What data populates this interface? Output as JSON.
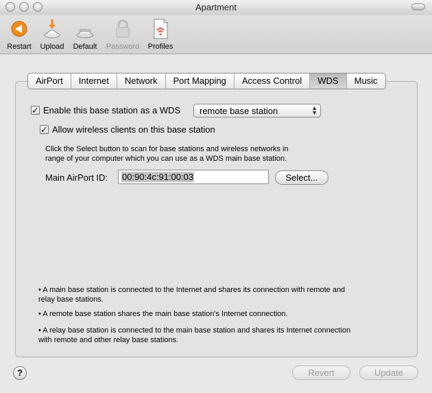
{
  "window": {
    "title": "Apartment"
  },
  "toolbar": {
    "items": [
      {
        "label": "Restart",
        "icon": "restart-icon",
        "enabled": true
      },
      {
        "label": "Upload",
        "icon": "upload-icon",
        "enabled": true
      },
      {
        "label": "Default",
        "icon": "default-icon",
        "enabled": true
      },
      {
        "label": "Password",
        "icon": "lock-icon",
        "enabled": false
      },
      {
        "label": "Profiles",
        "icon": "profiles-icon",
        "enabled": true
      }
    ]
  },
  "tabs": [
    {
      "label": "AirPort"
    },
    {
      "label": "Internet"
    },
    {
      "label": "Network"
    },
    {
      "label": "Port Mapping"
    },
    {
      "label": "Access Control"
    },
    {
      "label": "WDS",
      "active": true
    },
    {
      "label": "Music"
    }
  ],
  "wds": {
    "enable_label": "Enable this base station as a WDS",
    "enable_checked": true,
    "mode_value": "remote base station",
    "allow_label": "Allow wireless clients on this base station",
    "allow_checked": true,
    "instructions_line1": "Click the Select button to scan for base stations and wireless networks in",
    "instructions_line2": "range of your computer which you can use as a WDS main base station.",
    "main_id_label": "Main AirPort ID:",
    "main_id_value": "00:90:4c:91:00:03",
    "select_button": "Select..."
  },
  "notes": {
    "main_line1": "• A main base station is connected to the Internet and shares its connection with remote and",
    "main_line2": "relay base stations.",
    "remote": "• A remote base station shares the main base station's Internet connection.",
    "relay_line1": "• A relay base station is connected to the main base station and shares its Internet connection",
    "relay_line2": "with remote and other relay base stations."
  },
  "footer": {
    "help": "?",
    "revert": "Revert",
    "update": "Update"
  },
  "colors": {
    "accent_orange": "#f28b1c",
    "disabled_text": "#8e8e8e"
  }
}
